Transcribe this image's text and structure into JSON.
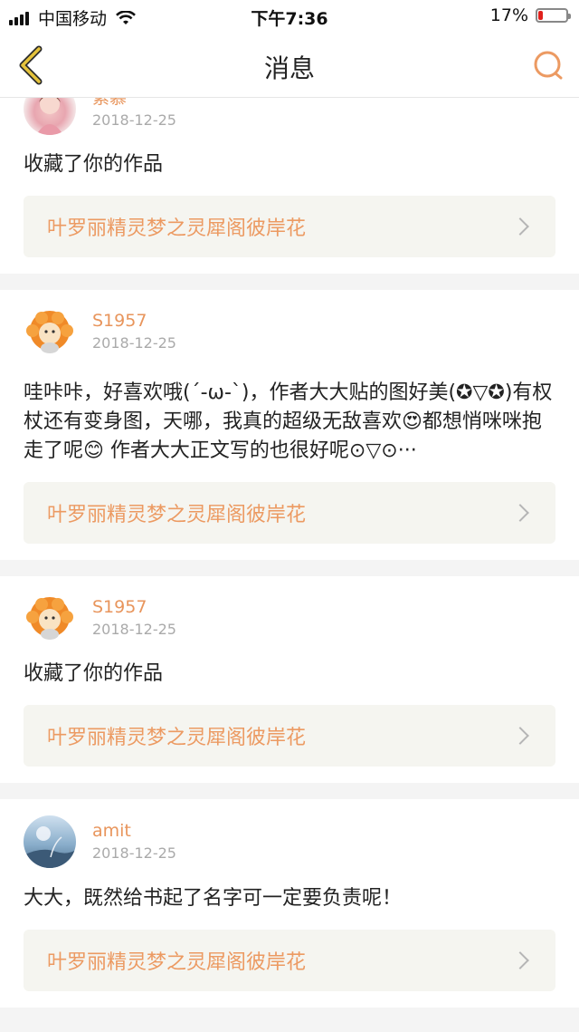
{
  "status_bar": {
    "carrier": "中国移动",
    "time": "下午7:36",
    "battery_percent": "17%",
    "battery_level": 0.17,
    "battery_color": "#e0211c"
  },
  "nav": {
    "title": "消息",
    "back_icon": "chevron-left-icon",
    "search_icon": "search-icon",
    "accent_back": "#e5c33c",
    "accent_search": "#ec9a62"
  },
  "messages": [
    {
      "username": "紫慕",
      "date": "2018-12-25",
      "avatar": "girl-avatar",
      "text": "收藏了你的作品",
      "work": "叶罗丽精灵梦之灵犀阁彼岸花"
    },
    {
      "username": "S1957",
      "date": "2018-12-25",
      "avatar": "lion-avatar",
      "text": "哇咔咔，好喜欢哦(´-ω-`)，作者大大贴的图好美(✪▽✪)有权杖还有变身图，天哪，我真的超级无敌喜欢😍都想悄咪咪抱走了呢😊 作者大大正文写的也很好呢⊙▽⊙···",
      "work": "叶罗丽精灵梦之灵犀阁彼岸花"
    },
    {
      "username": "S1957",
      "date": "2018-12-25",
      "avatar": "lion-avatar",
      "text": "收藏了你的作品",
      "work": "叶罗丽精灵梦之灵犀阁彼岸花"
    },
    {
      "username": "amit",
      "date": "2018-12-25",
      "avatar": "sky-avatar",
      "text": "大大，既然给书起了名字可一定要负责呢！",
      "work": "叶罗丽精灵梦之灵犀阁彼岸花"
    }
  ],
  "colors": {
    "username": "#e8955c",
    "work_link_text": "#ec9a62",
    "work_link_bg": "#f5f5f0"
  }
}
